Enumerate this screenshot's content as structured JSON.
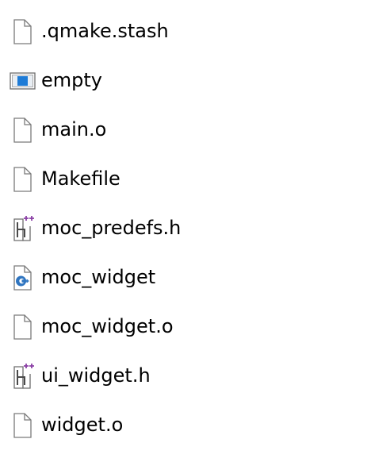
{
  "files": [
    {
      "name": ".qmake.stash",
      "icon": "blank-file-icon"
    },
    {
      "name": "empty",
      "icon": "application-window-icon"
    },
    {
      "name": "main.o",
      "icon": "blank-file-icon"
    },
    {
      "name": "Makefile",
      "icon": "blank-file-icon"
    },
    {
      "name": "moc_predefs.h",
      "icon": "cpp-header-file-icon"
    },
    {
      "name": "moc_widget",
      "icon": "cpp-source-file-icon"
    },
    {
      "name": "moc_widget.o",
      "icon": "blank-file-icon"
    },
    {
      "name": "ui_widget.h",
      "icon": "cpp-header-file-icon"
    },
    {
      "name": "widget.o",
      "icon": "blank-file-icon"
    }
  ],
  "colors": {
    "icon_outline": "#7a7a7a",
    "icon_fill": "#ffffff",
    "app_blue": "#1e7bd6",
    "header_purple": "#8a3fa5",
    "cpp_blue": "#2f75c0",
    "text": "#000000"
  }
}
